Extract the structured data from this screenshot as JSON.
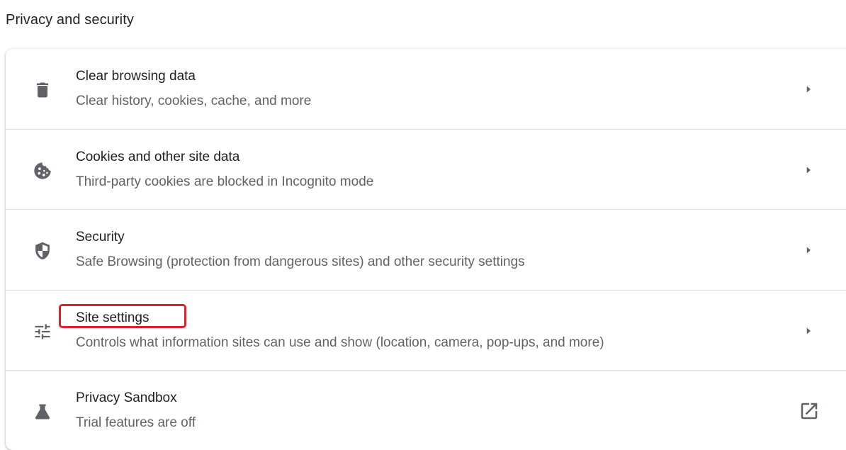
{
  "section": {
    "title": "Privacy and security"
  },
  "items": [
    {
      "title": "Clear browsing data",
      "subtitle": "Clear history, cookies, cache, and more",
      "icon": "trash-icon",
      "action_icon": "chevron-right-icon"
    },
    {
      "title": "Cookies and other site data",
      "subtitle": "Third-party cookies are blocked in Incognito mode",
      "icon": "cookie-icon",
      "action_icon": "chevron-right-icon"
    },
    {
      "title": "Security",
      "subtitle": "Safe Browsing (protection from dangerous sites) and other security settings",
      "icon": "shield-icon",
      "action_icon": "chevron-right-icon"
    },
    {
      "title": "Site settings",
      "subtitle": "Controls what information sites can use and show (location, camera, pop-ups, and more)",
      "icon": "tune-sliders-icon",
      "action_icon": "chevron-right-icon",
      "highlighted": true
    },
    {
      "title": "Privacy Sandbox",
      "subtitle": "Trial features are off",
      "icon": "flask-icon",
      "action_icon": "open-in-new-icon"
    }
  ],
  "colors": {
    "primary_text": "#202124",
    "secondary_text": "#5f6368",
    "divider": "#dadce0",
    "highlight": "#e0202a"
  }
}
